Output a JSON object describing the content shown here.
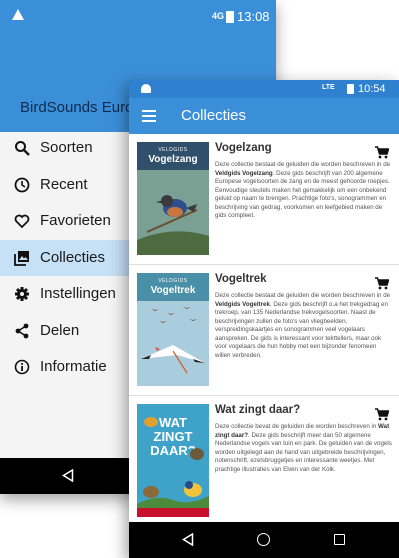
{
  "back_screen": {
    "status_time": "13:08",
    "status_network": "4G",
    "app_title": "BirdSounds Europe",
    "menu": [
      {
        "label": "Soorten",
        "icon": "search-icon",
        "active": false
      },
      {
        "label": "Recent",
        "icon": "clock-icon",
        "active": false
      },
      {
        "label": "Favorieten",
        "icon": "heart-icon",
        "active": false
      },
      {
        "label": "Collecties",
        "icon": "collections-icon",
        "active": true
      },
      {
        "label": "Instellingen",
        "icon": "gear-icon",
        "active": false
      },
      {
        "label": "Delen",
        "icon": "share-icon",
        "active": false
      },
      {
        "label": "Informatie",
        "icon": "info-icon",
        "active": false
      }
    ]
  },
  "front_screen": {
    "status_time": "10:54",
    "status_network": "LTE",
    "title": "Collecties",
    "collections": [
      {
        "title": "Vogelzang",
        "cover_label": "VELDGIDS",
        "cover_title": "Vogelzang",
        "desc_before": "Deze collectie bestaat de geluiden die worden beschreven in de ",
        "desc_bold": "Veldgids Vogelzang",
        "desc_after": ". Deze gids beschrijft van 200 algemene Europese vogelsoorten de zang en de meest gehoorde roepjes. Eenvoudige sleutels maken het gemakkelijk om een onbekend geluid op naam te brengen. Prachtige foto's, sonogrammen en beschrijving van gedrag, voorkomen en leefgebied maken de gids compleet."
      },
      {
        "title": "Vogeltrek",
        "cover_label": "VELDGIDS",
        "cover_title": "Vogeltrek",
        "desc_before": "Deze collectie bestaat de geluiden die worden beschreven in de ",
        "desc_bold": "Veldgids Vogeltrek",
        "desc_after": ". Deze gids beschrijft o.a het trekgedrag en trekroep, van 135 Nederlandse trekvogelsoorten. Naast de beschrijvingen zullen de foto's van vliegbeelden, verspreidingskaartjes en sonogrammen veel vogelaars aanspreken. De gids is interessant voor tekttellers, maar ook voor vogelaars die hun hobby met een bijzonder fenomeen willen verbreden."
      },
      {
        "title": "Wat zingt daar?",
        "cover_label": "",
        "cover_title": "WAT ZINGT DAAR?",
        "desc_before": "Deze collectie bevat de geluiden die worden beschreven in ",
        "desc_bold": "Wat zingt daar?",
        "desc_after": ". Deze gids beschrijft meer dan 50 algemene Nederlandse vogels van tuin en park. De geluiden van de vogels worden uitgelegd aan de hand van uitgebreide beschrijvingen, notenschrift, ezelsbruggetjes en interessante weetjes. Met prachtige illustraties van Elwin van der Kolk."
      }
    ]
  },
  "colors": {
    "primary": "#3b8fd9",
    "status": "#2f80cf",
    "active_item": "#c6e0f6"
  }
}
